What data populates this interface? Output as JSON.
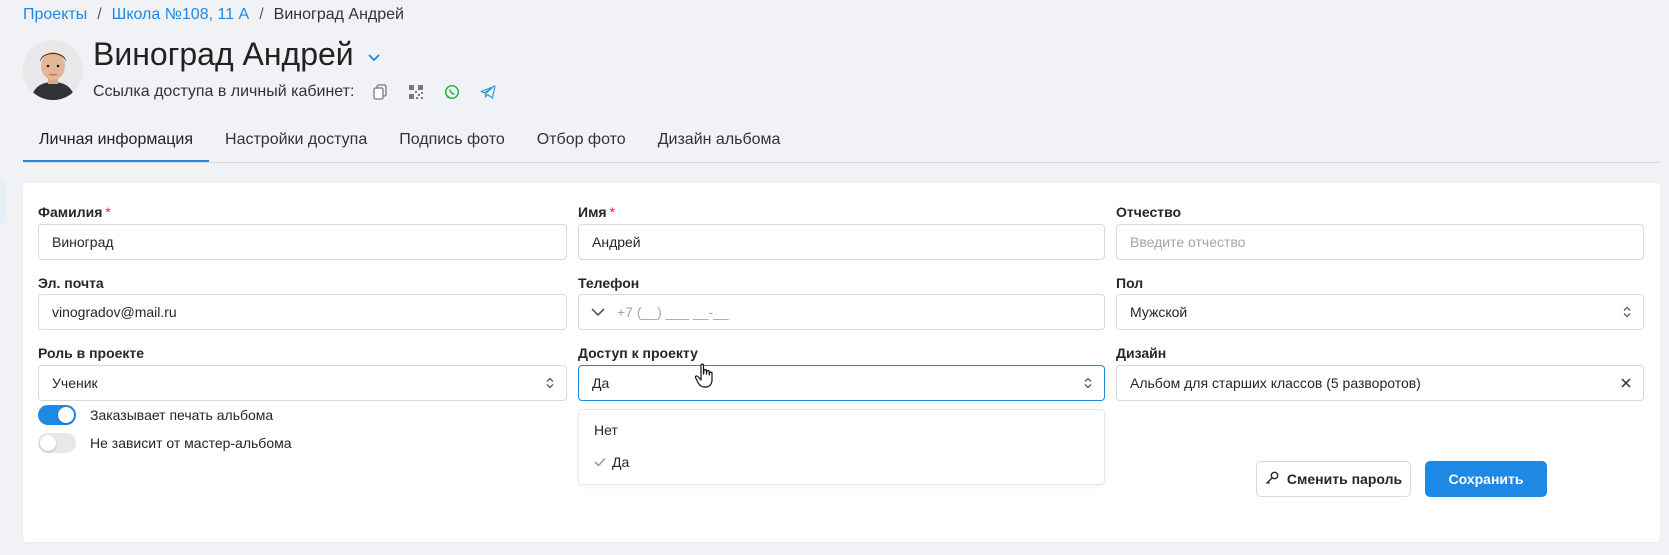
{
  "breadcrumb": {
    "projects": "Проекты",
    "sep1": "/",
    "school": "Школа №108, 11 А",
    "sep2": "/",
    "current": "Виноград Андрей"
  },
  "header": {
    "title": "Виноград Андрей",
    "access_link_label": "Ссылка доступа в личный кабинет:",
    "icons": [
      "copy-icon",
      "qr-code-icon",
      "whatsapp-icon",
      "telegram-icon"
    ]
  },
  "tabs": [
    "Личная информация",
    "Настройки доступа",
    "Подпись фото",
    "Отбор фото",
    "Дизайн альбома"
  ],
  "active_tab": "Личная информация",
  "form": {
    "surname": {
      "label": "Фамилия",
      "required": "*",
      "value": "Виноград"
    },
    "name": {
      "label": "Имя",
      "required": "*",
      "value": "Андрей"
    },
    "patronymic": {
      "label": "Отчество",
      "placeholder": "Введите отчество"
    },
    "email": {
      "label": "Эл. почта",
      "value": "vinogradov@mail.ru"
    },
    "phone": {
      "label": "Телефон",
      "placeholder": "+7 (__) ___ __-__"
    },
    "gender": {
      "label": "Пол",
      "value": "Мужской"
    },
    "role": {
      "label": "Роль в проекте",
      "value": "Ученик"
    },
    "access": {
      "label": "Доступ к проекту",
      "value": "Да",
      "options": [
        "Нет",
        "Да"
      ]
    },
    "design": {
      "label": "Дизайн",
      "value": "Альбом для старших классов (5 разворотов)"
    },
    "toggles": [
      {
        "label": "Заказывает печать альбома",
        "on": true
      },
      {
        "label": "Не зависит от мастер-альбома",
        "on": false
      }
    ]
  },
  "buttons": {
    "change_password": "Сменить пароль",
    "save": "Сохранить"
  },
  "colors": {
    "accent": "#1e88e5",
    "required": "#f5222d",
    "whatsapp": "#25b34a",
    "telegram": "#2a9fd8"
  }
}
